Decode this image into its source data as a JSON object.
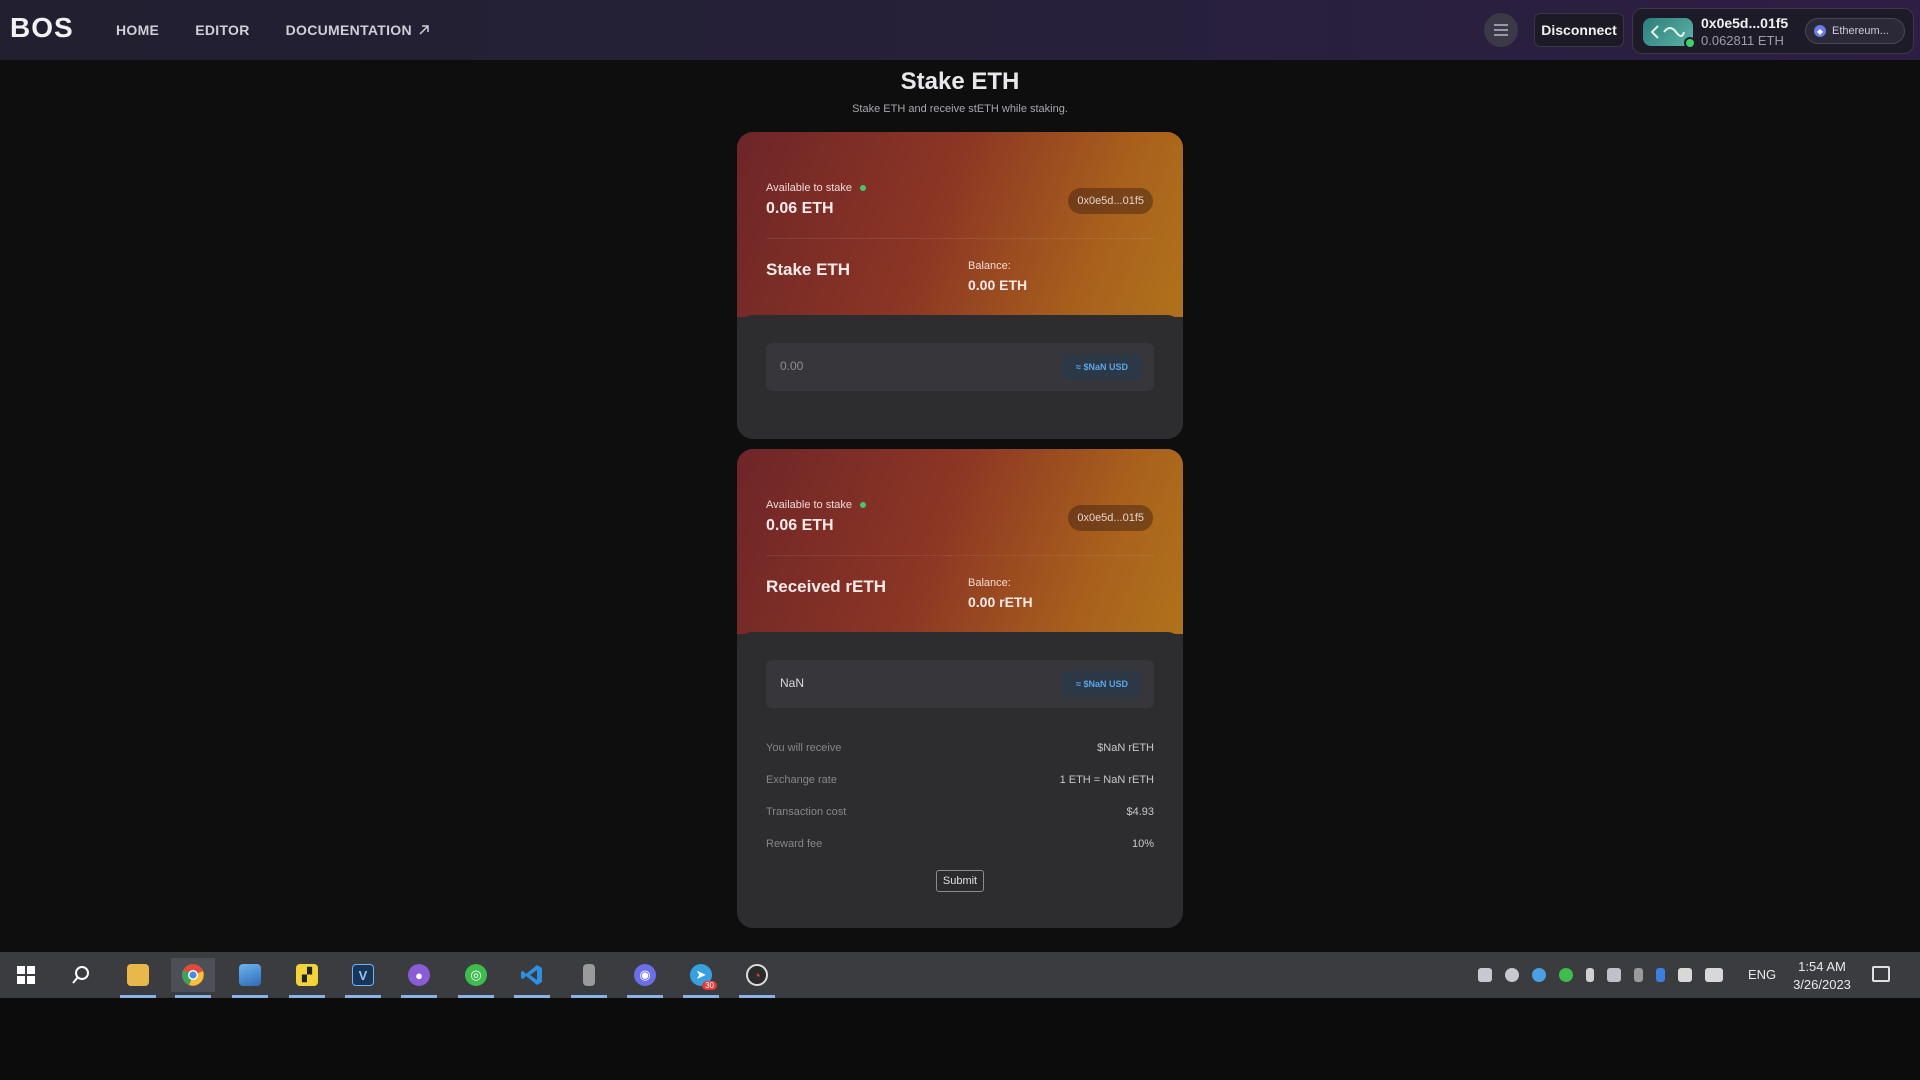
{
  "header": {
    "logo": "BOS",
    "nav": [
      {
        "label": "HOME"
      },
      {
        "label": "EDITOR"
      },
      {
        "label": "DOCUMENTATION",
        "external_icon": "arrow-up-right-icon"
      }
    ],
    "disconnect_label": "Disconnect",
    "wallet": {
      "address": "0x0e5d...01f5",
      "balance": "0.062811 ETH",
      "network": "Ethereum..."
    }
  },
  "page": {
    "title": "Stake ETH",
    "subtitle": "Stake ETH and receive stETH while staking."
  },
  "stake_card": {
    "available_label": "Available to stake",
    "available_value": "0.06 ETH",
    "address": "0x0e5d...01f5",
    "token_label": "Stake ETH",
    "balance_label": "Balance:",
    "balance_value": "0.00 ETH",
    "amount_placeholder": "0.00",
    "usd_value": "≈ $NaN USD"
  },
  "receive_card": {
    "available_label": "Available to stake",
    "available_value": "0.06 ETH",
    "address": "0x0e5d...01f5",
    "token_label": "Received rETH",
    "balance_label": "Balance:",
    "balance_value": "0.00 rETH",
    "amount_value": "NaN",
    "usd_value": "≈ $NaN USD",
    "details": [
      {
        "label": "You will receive",
        "value": "$NaN rETH"
      },
      {
        "label": "Exchange rate",
        "value": "1 ETH = NaN rETH"
      },
      {
        "label": "Transaction cost",
        "value": "$4.93"
      },
      {
        "label": "Reward fee",
        "value": "10%"
      }
    ],
    "submit_label": "Submit"
  },
  "taskbar": {
    "apps": [
      {
        "name": "windows-start-icon",
        "color": "#ffffff"
      },
      {
        "name": "search-icon",
        "color": "#ffffff"
      },
      {
        "name": "file-explorer-icon",
        "color": "#e8b84a"
      },
      {
        "name": "chrome-icon",
        "color": "#e04b3a"
      },
      {
        "name": "photos-icon",
        "color": "#3f8fd8"
      },
      {
        "name": "sticky-notes-icon",
        "color": "#f2d43a"
      },
      {
        "name": "v-app-icon",
        "color": "#1e6fb8"
      },
      {
        "name": "github-icon",
        "color": "#8a5cd6"
      },
      {
        "name": "wechat-icon",
        "color": "#3ebd4e"
      },
      {
        "name": "vscode-icon",
        "color": "#2f8fe0"
      },
      {
        "name": "usb-device-icon",
        "color": "#9a9a9a"
      },
      {
        "name": "discord-icon",
        "color": "#6a6ee8"
      },
      {
        "name": "telegram-icon",
        "color": "#37a0e0"
      },
      {
        "name": "clock-app-icon",
        "color": "#e23a3a"
      }
    ],
    "telegram_badge": "30",
    "tray": [
      "discord-tray-icon",
      "steam-tray-icon",
      "telegram-tray-icon",
      "wechat-tray-icon",
      "mic-tray-icon",
      "app-tray-icon",
      "usb-tray-icon",
      "bluetooth-icon",
      "volume-icon",
      "network-icon"
    ],
    "language": "ENG",
    "time": "1:54 AM",
    "date": "3/26/2023"
  }
}
